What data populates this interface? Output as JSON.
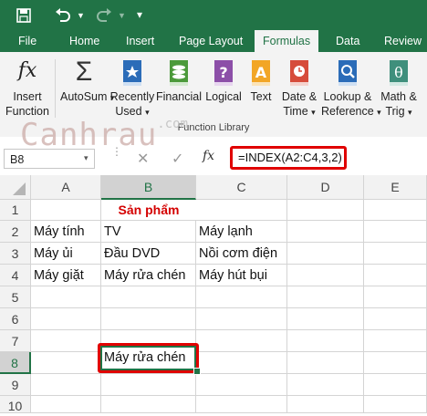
{
  "quick_access": {
    "save_icon": "save-icon",
    "undo_icon": "undo-icon",
    "redo_icon": "redo-icon"
  },
  "tabs": [
    {
      "label": "File"
    },
    {
      "label": "Home"
    },
    {
      "label": "Insert"
    },
    {
      "label": "Page Layout"
    },
    {
      "label": "Formulas",
      "active": true
    },
    {
      "label": "Data"
    },
    {
      "label": "Review"
    }
  ],
  "ribbon": {
    "buttons": [
      {
        "line1": "Insert",
        "line2": "Function",
        "icon": "fx-icon"
      },
      {
        "line1": "AutoSum",
        "line2": "",
        "icon": "sigma-icon"
      },
      {
        "line1": "Recently",
        "line2": "Used",
        "icon": "star-book-icon"
      },
      {
        "line1": "Financial",
        "line2": "",
        "icon": "coins-icon"
      },
      {
        "line1": "Logical",
        "line2": "",
        "icon": "question-book-icon"
      },
      {
        "line1": "Text",
        "line2": "",
        "icon": "text-a-icon"
      },
      {
        "line1": "Date &",
        "line2": "Time",
        "icon": "calendar-clock-icon"
      },
      {
        "line1": "Lookup &",
        "line2": "Reference",
        "icon": "magnifier-book-icon"
      },
      {
        "line1": "Math &",
        "line2": "Trig",
        "icon": "theta-book-icon"
      }
    ],
    "group_label": "Function Library"
  },
  "watermark": {
    "text": "Canhrau",
    "suffix": ".com"
  },
  "formula_bar": {
    "name_box": "B8",
    "fx": "fx",
    "formula": "=INDEX(A2:C4,3,2)"
  },
  "columns": [
    "A",
    "B",
    "C",
    "D",
    "E"
  ],
  "rows": [
    "1",
    "2",
    "3",
    "4",
    "5",
    "6",
    "7",
    "8",
    "9",
    "10"
  ],
  "cells": {
    "B1": "Sản phẩm",
    "A2": "Máy tính",
    "B2": "TV",
    "C2": "Máy lạnh",
    "A3": "Máy ủi",
    "B3": "Đầu DVD",
    "C3": "Nồi cơm điện",
    "A4": "Máy giặt",
    "B4": "Máy rửa chén",
    "C4": "Máy hút bụi",
    "B8": "Máy rửa chén"
  },
  "colors": {
    "excel_green": "#217346",
    "highlight_red": "#e00000",
    "title_red": "#d40000"
  }
}
